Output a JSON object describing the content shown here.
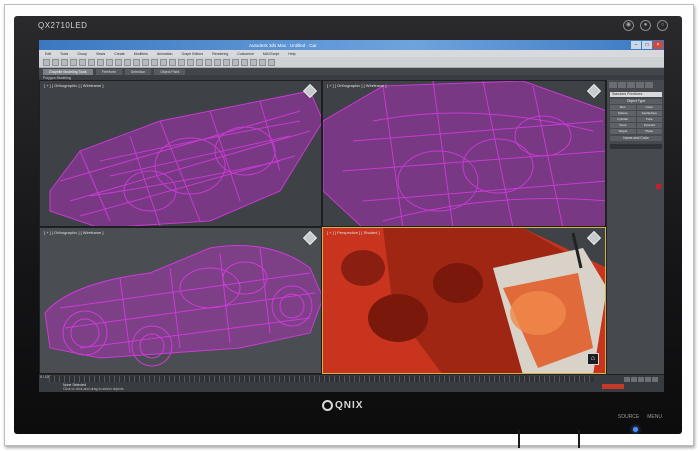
{
  "monitor": {
    "model": "QX2710LED",
    "brand": "QNIX",
    "bottom_controls": [
      "SOURCE",
      "MENU"
    ]
  },
  "app": {
    "title": "Autodesk 3ds Max · Untitled · Car",
    "menu": [
      "Edit",
      "Tools",
      "Group",
      "Views",
      "Create",
      "Modifiers",
      "Animation",
      "Graph Editors",
      "Rendering",
      "Customize",
      "MAXScript",
      "Help"
    ],
    "ribbon_tabs": [
      "Graphite Modeling Tools",
      "Freeform",
      "Selection",
      "Object Paint"
    ],
    "sub_ribbon": "Polygon Modeling"
  },
  "viewports": {
    "top_left": "[ + ] [ Orthographic ] [ Wireframe ]",
    "top_right": "[ + ] [ Orthographic ] [ Wireframe ]",
    "bottom_left": "[ + ] [ Orthographic ] [ Wireframe ]",
    "bottom_right": "[ + ] [ Perspective ] [ Shaded ]"
  },
  "command_panel": {
    "dropdown": "Standard Primitives",
    "section": "Object Type",
    "buttons": [
      "Box",
      "Cone",
      "Sphere",
      "GeoSphere",
      "Cylinder",
      "Tube",
      "Torus",
      "Pyramid",
      "Teapot",
      "Plane"
    ],
    "name_label": "Name and Color"
  },
  "timeline": {
    "frame_counter": "0 / 100",
    "status_line1": "None Selected",
    "status_line2": "Click or click-and-drag to select objects"
  },
  "colors": {
    "wireframe": "#d43be0",
    "render_red": "#c9341f",
    "titlebar": "#3b78c0",
    "viewport_bg": "#3e4146",
    "power_led": "#4f8cff"
  }
}
